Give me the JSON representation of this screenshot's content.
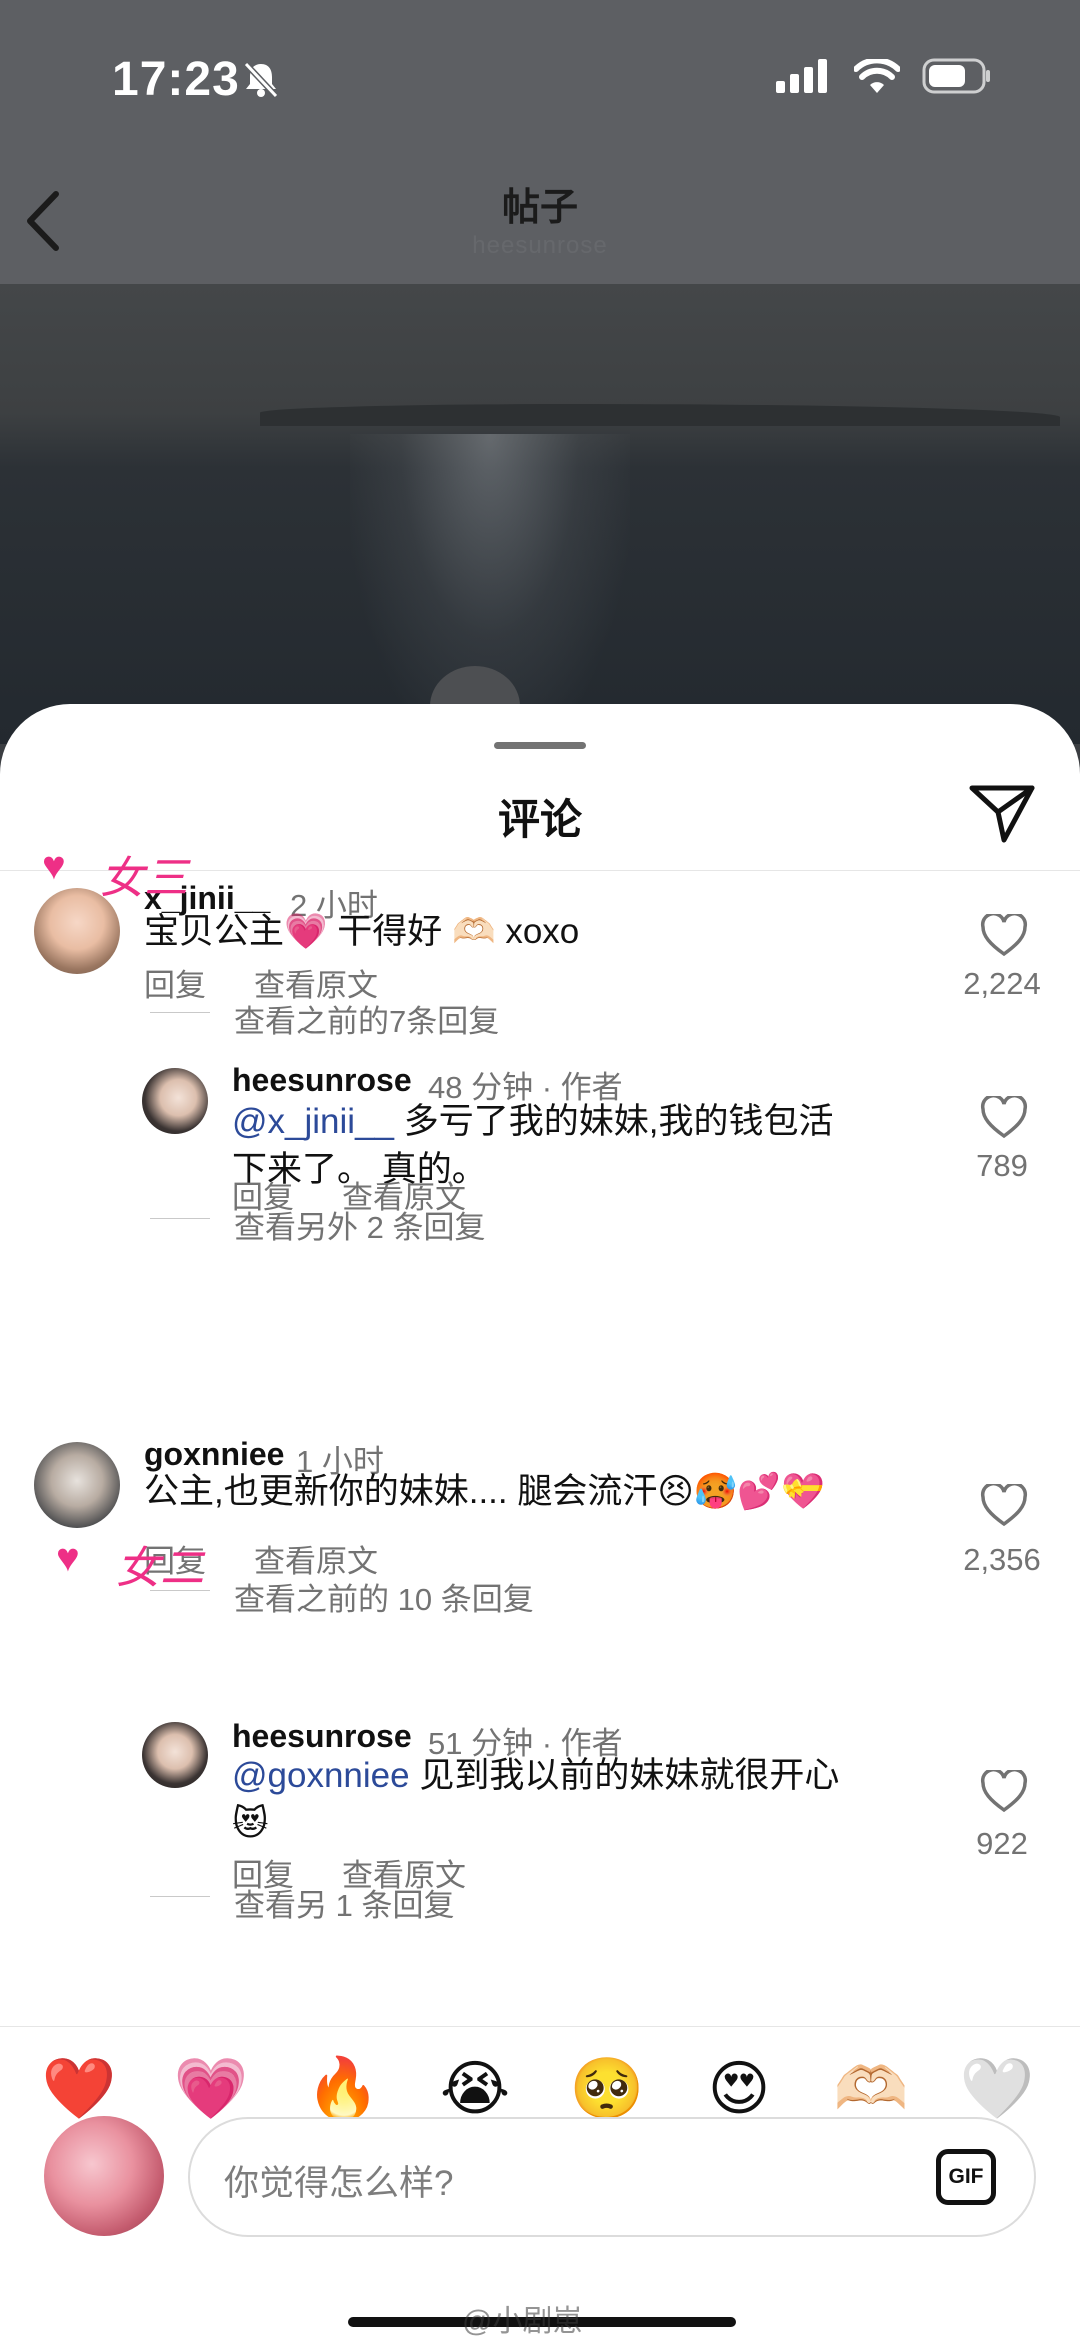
{
  "status_bar": {
    "time": "17:23"
  },
  "header": {
    "title": "帖子",
    "subtitle": "heesunrose"
  },
  "sheet": {
    "title": "评论"
  },
  "comments": [
    {
      "username": "x_jinii__",
      "time": "2 小时",
      "text": "宝贝公主💗 干得好 🫶🏻 xoxo",
      "actions": [
        "回复",
        "查看原文"
      ],
      "view_replies": "查看之前的7条回复",
      "likes": "2,224"
    },
    {
      "username": "heesunrose",
      "time": "48 分钟 · 作者",
      "mention": "@x_jinii__",
      "text_line1": " 多亏了我的妹妹,我的钱包活",
      "text_line2": "下来了。 真的。",
      "actions": [
        "回复",
        "查看原文"
      ],
      "view_replies": "查看另外 2 条回复",
      "likes": "789"
    },
    {
      "username": "goxnniee",
      "time": "1 小时",
      "text": "公主,也更新你的妹妹.... 腿会流汗😣🥵💕💝",
      "actions": [
        "回复",
        "查看原文"
      ],
      "view_replies": "查看之前的 10 条回复",
      "likes": "2,356"
    },
    {
      "username": "heesunrose",
      "time": "51 分钟 · 作者",
      "mention": "@goxnniee",
      "text_line1": " 见到我以前的妹妹就很开心",
      "text_line2": "😻",
      "actions": [
        "回复",
        "查看原文"
      ],
      "view_replies": "查看另 1 条回复",
      "likes": "922"
    }
  ],
  "stamps": [
    "女三",
    "女二"
  ],
  "emoji_bar": [
    "❤️",
    "💗",
    "🔥",
    "😭",
    "🥺",
    "😍",
    "🫶🏻",
    "🤍"
  ],
  "composer": {
    "placeholder": "你觉得怎么样?",
    "gif_label": "GIF"
  },
  "watermark": "@小剧崽"
}
